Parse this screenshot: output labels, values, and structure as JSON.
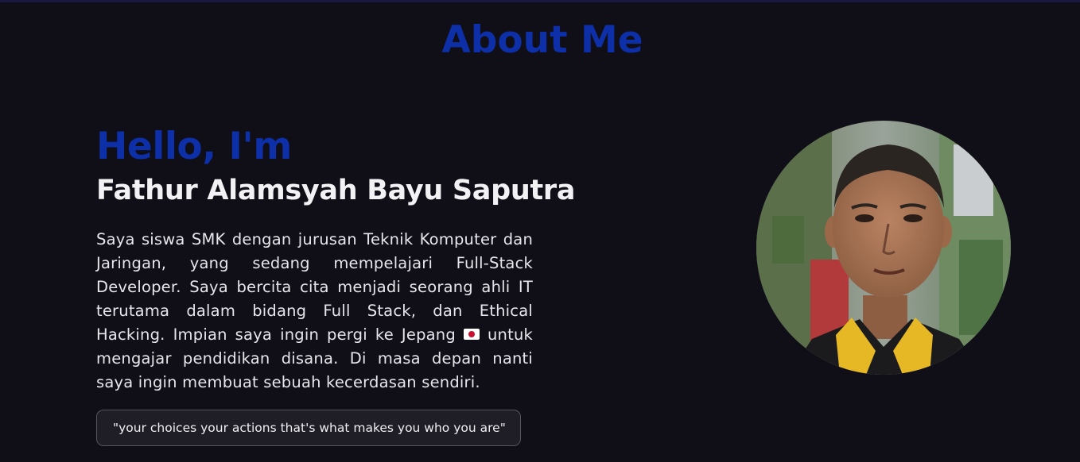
{
  "section": {
    "title": "About Me"
  },
  "intro": {
    "greeting": "Hello, I'm",
    "name": "Fathur Alamsyah Bayu Saputra"
  },
  "bio": {
    "part1": "Saya siswa SMK dengan jurusan Teknik Komputer dan Jaringan, yang sedang mempelajari Full-Stack Developer. Saya bercita cita menjadi seorang ahli IT terutama dalam bidang Full Stack, dan Ethical Hacking. Impian saya ingin pergi ke Jepang",
    "part2": "untuk mengajar pendidikan disana. Di masa depan nanti saya ingin membuat sebuah kecerdasan sendiri.",
    "flag_icon": "japan-flag-icon"
  },
  "quote": {
    "text": "\"your choices your actions that's what makes you who you are\""
  },
  "profile": {
    "photo_icon": "profile-photo"
  },
  "colors": {
    "background": "#100f17",
    "accent": "#0d2fa8",
    "text": "#e9e9ef"
  }
}
